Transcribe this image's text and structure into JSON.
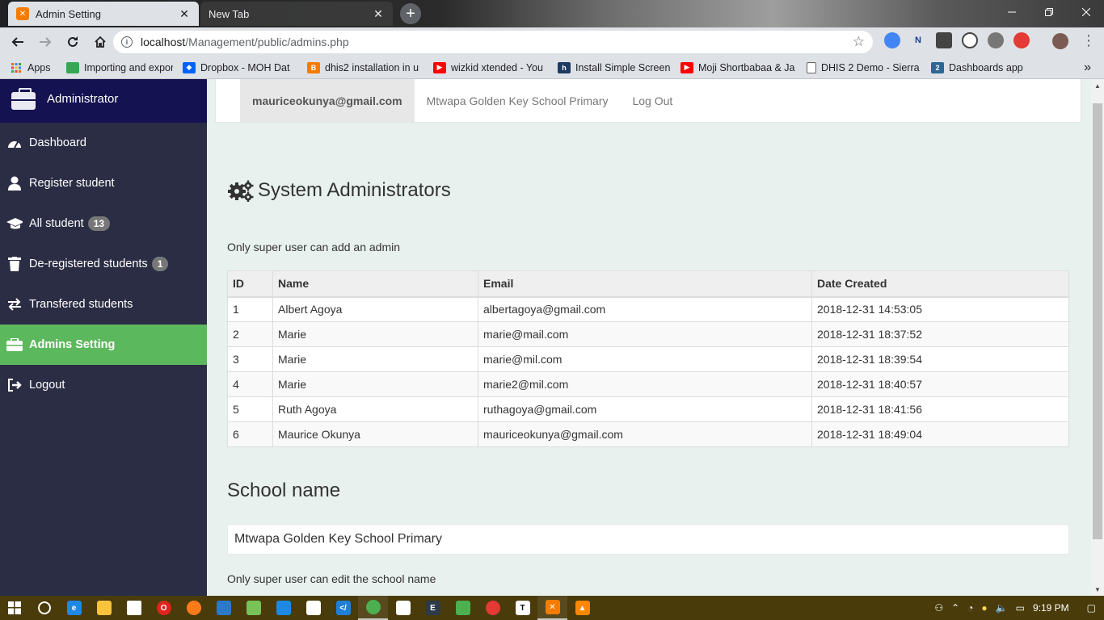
{
  "browser": {
    "tabs": [
      {
        "title": "Admin Setting",
        "active": true
      },
      {
        "title": "New Tab",
        "active": false
      }
    ],
    "url_host": "localhost",
    "url_path": "/Management/public/admins.php",
    "bookmarks": [
      {
        "label": "Apps",
        "icon": "apps-grid-icon",
        "color": "#e8710a"
      },
      {
        "label": "Importing and expor",
        "icon": "import-icon",
        "color": "#34a853"
      },
      {
        "label": "Dropbox - MOH Dat",
        "icon": "dropbox-icon",
        "color": "#0061fe"
      },
      {
        "label": "dhis2 installation in u",
        "icon": "blogger-icon",
        "color": "#f57c00"
      },
      {
        "label": "wizkid xtended - You",
        "icon": "youtube-icon",
        "color": "#ff0000"
      },
      {
        "label": "Install Simple Screen",
        "icon": "hashnode-icon",
        "color": "#1f3a60"
      },
      {
        "label": "Moji Shortbabaa & Ja",
        "icon": "youtube-icon",
        "color": "#ff0000"
      },
      {
        "label": "DHIS 2 Demo - Sierra",
        "icon": "page-icon",
        "color": "#ffffff"
      },
      {
        "label": "Dashboards app",
        "icon": "dhis2-icon",
        "color": "#2c6693"
      }
    ]
  },
  "sidebar": {
    "title": "Administrator",
    "items": [
      {
        "label": "Dashboard",
        "icon": "dashboard-icon",
        "badge": null
      },
      {
        "label": "Register student",
        "icon": "user-icon",
        "badge": null
      },
      {
        "label": "All student",
        "icon": "graduation-cap-icon",
        "badge": "13"
      },
      {
        "label": "De-registered students",
        "icon": "trash-icon",
        "badge": "1"
      },
      {
        "label": "Transfered students",
        "icon": "exchange-icon",
        "badge": null
      },
      {
        "label": "Admins Setting",
        "icon": "briefcase-icon",
        "badge": null,
        "active": true
      },
      {
        "label": "Logout",
        "icon": "sign-out-icon",
        "badge": null
      }
    ]
  },
  "topnav": {
    "user_email": "mauriceokunya@gmail.com",
    "school": "Mtwapa Golden Key School Primary",
    "logout": "Log Out"
  },
  "page": {
    "title": "System Administrators",
    "notice": "Only super user can add an admin",
    "table": {
      "headers": [
        "ID",
        "Name",
        "Email",
        "Date Created"
      ],
      "rows": [
        [
          "1",
          "Albert Agoya",
          "albertagoya@gmail.com",
          "2018-12-31 14:53:05"
        ],
        [
          "2",
          "Marie",
          "marie@mail.com",
          "2018-12-31 18:37:52"
        ],
        [
          "3",
          "Marie",
          "marie@mil.com",
          "2018-12-31 18:39:54"
        ],
        [
          "4",
          "Marie",
          "marie2@mil.com",
          "2018-12-31 18:40:57"
        ],
        [
          "5",
          "Ruth Agoya",
          "ruthagoya@gmail.com",
          "2018-12-31 18:41:56"
        ],
        [
          "6",
          "Maurice Okunya",
          "mauriceokunya@gmail.com",
          "2018-12-31 18:49:04"
        ]
      ]
    },
    "school_heading": "School name",
    "school_value": "Mtwapa Golden Key School Primary",
    "school_note": "Only super user can edit the school name"
  },
  "taskbar": {
    "time": "9:19 PM"
  },
  "colors": {
    "sidebar_bg": "#2b2d45",
    "sidebar_header": "#141250",
    "active_green": "#5cb85c",
    "page_bg": "#e8f1ee"
  }
}
